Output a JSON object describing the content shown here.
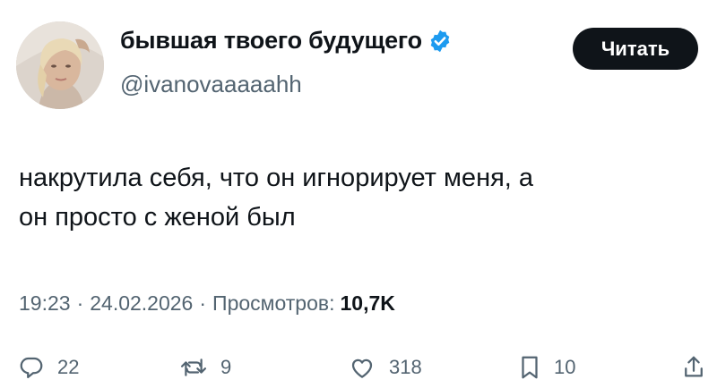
{
  "author": {
    "display_name": "бывшая твоего будущего",
    "handle": "@ivanovaaaaahh",
    "verified_color": "#1d9bf0"
  },
  "follow_button": {
    "label": "Читать"
  },
  "tweet": {
    "lines": [
      "накрутила себя, что он игнорирует меня, а",
      "он просто с женой был"
    ]
  },
  "meta": {
    "time": "19:23",
    "date": "24.02.2026",
    "views_label": "Просмотров:",
    "views_count": "10,7K"
  },
  "actions": {
    "replies": "22",
    "reposts": "9",
    "likes": "318",
    "bookmarks": "10"
  },
  "icons": [
    "reply-icon",
    "repost-icon",
    "like-icon",
    "bookmark-icon",
    "share-icon",
    "verified-icon"
  ]
}
